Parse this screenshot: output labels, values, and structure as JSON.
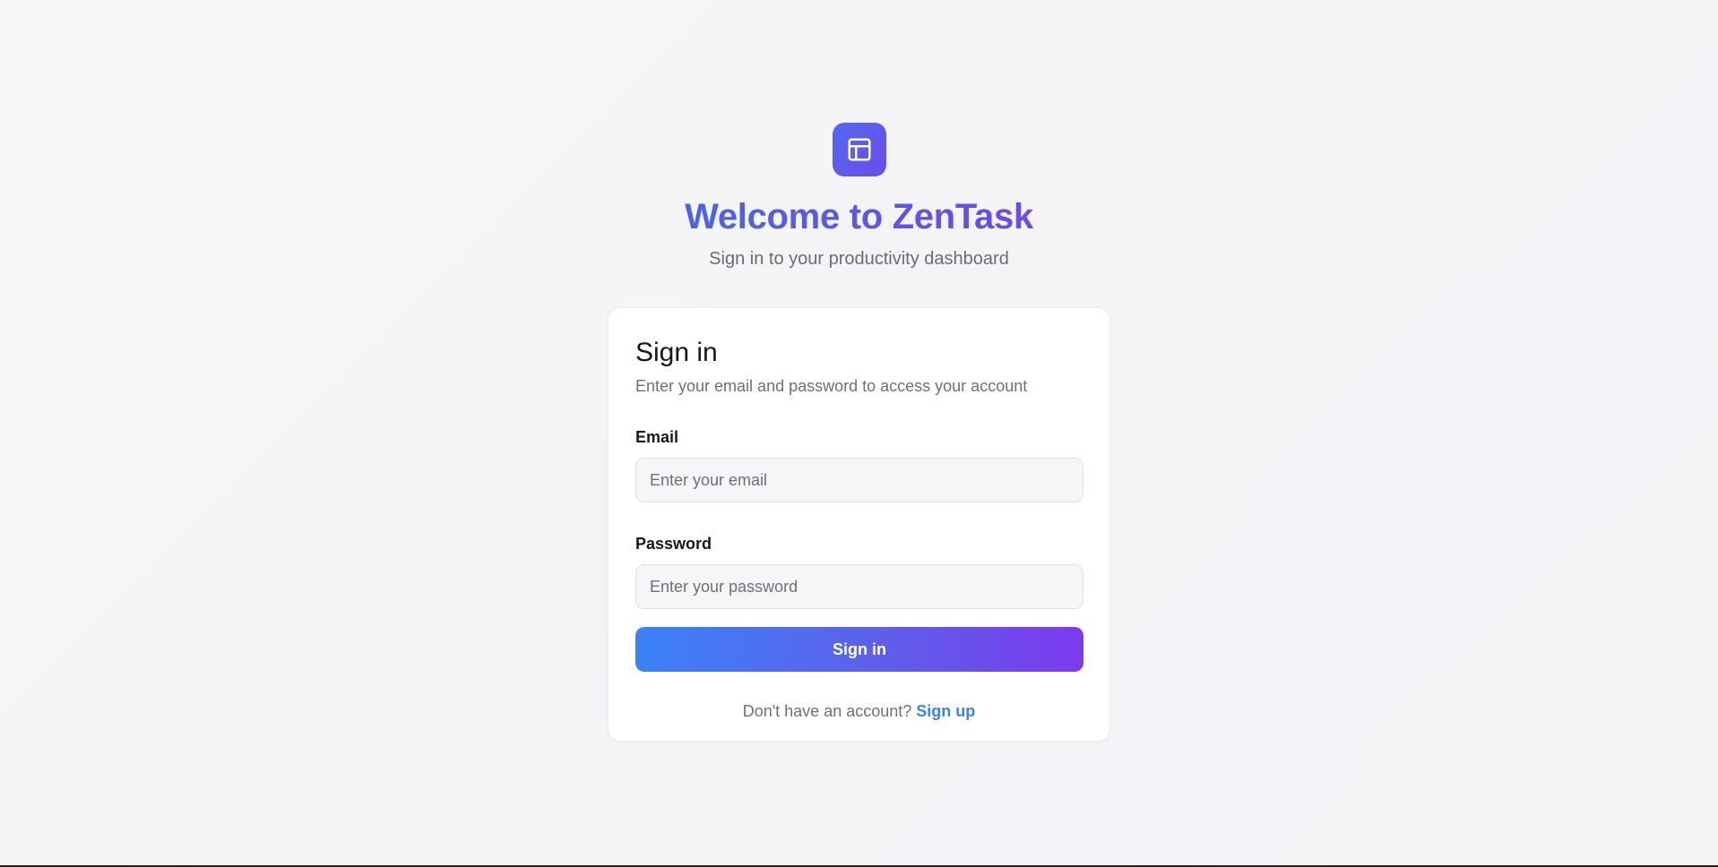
{
  "app": {
    "logo_icon": "layout-icon",
    "title": "Welcome to ZenTask",
    "subtitle": "Sign in to your productivity dashboard"
  },
  "signin_card": {
    "title": "Sign in",
    "description": "Enter your email and password to access your account",
    "email": {
      "label": "Email",
      "value": "",
      "placeholder": "Enter your email"
    },
    "password": {
      "label": "Password",
      "value": "",
      "placeholder": "Enter your password"
    },
    "submit_label": "Sign in",
    "footer_prompt": "Don't have an account?",
    "signup_link": "Sign up"
  },
  "colors": {
    "accent_blue": "#3b82f6",
    "accent_purple": "#7c3aed",
    "logo_gradient_start": "#4f6bf0",
    "logo_gradient_end": "#6d4aea",
    "background": "#f5f5f8"
  }
}
